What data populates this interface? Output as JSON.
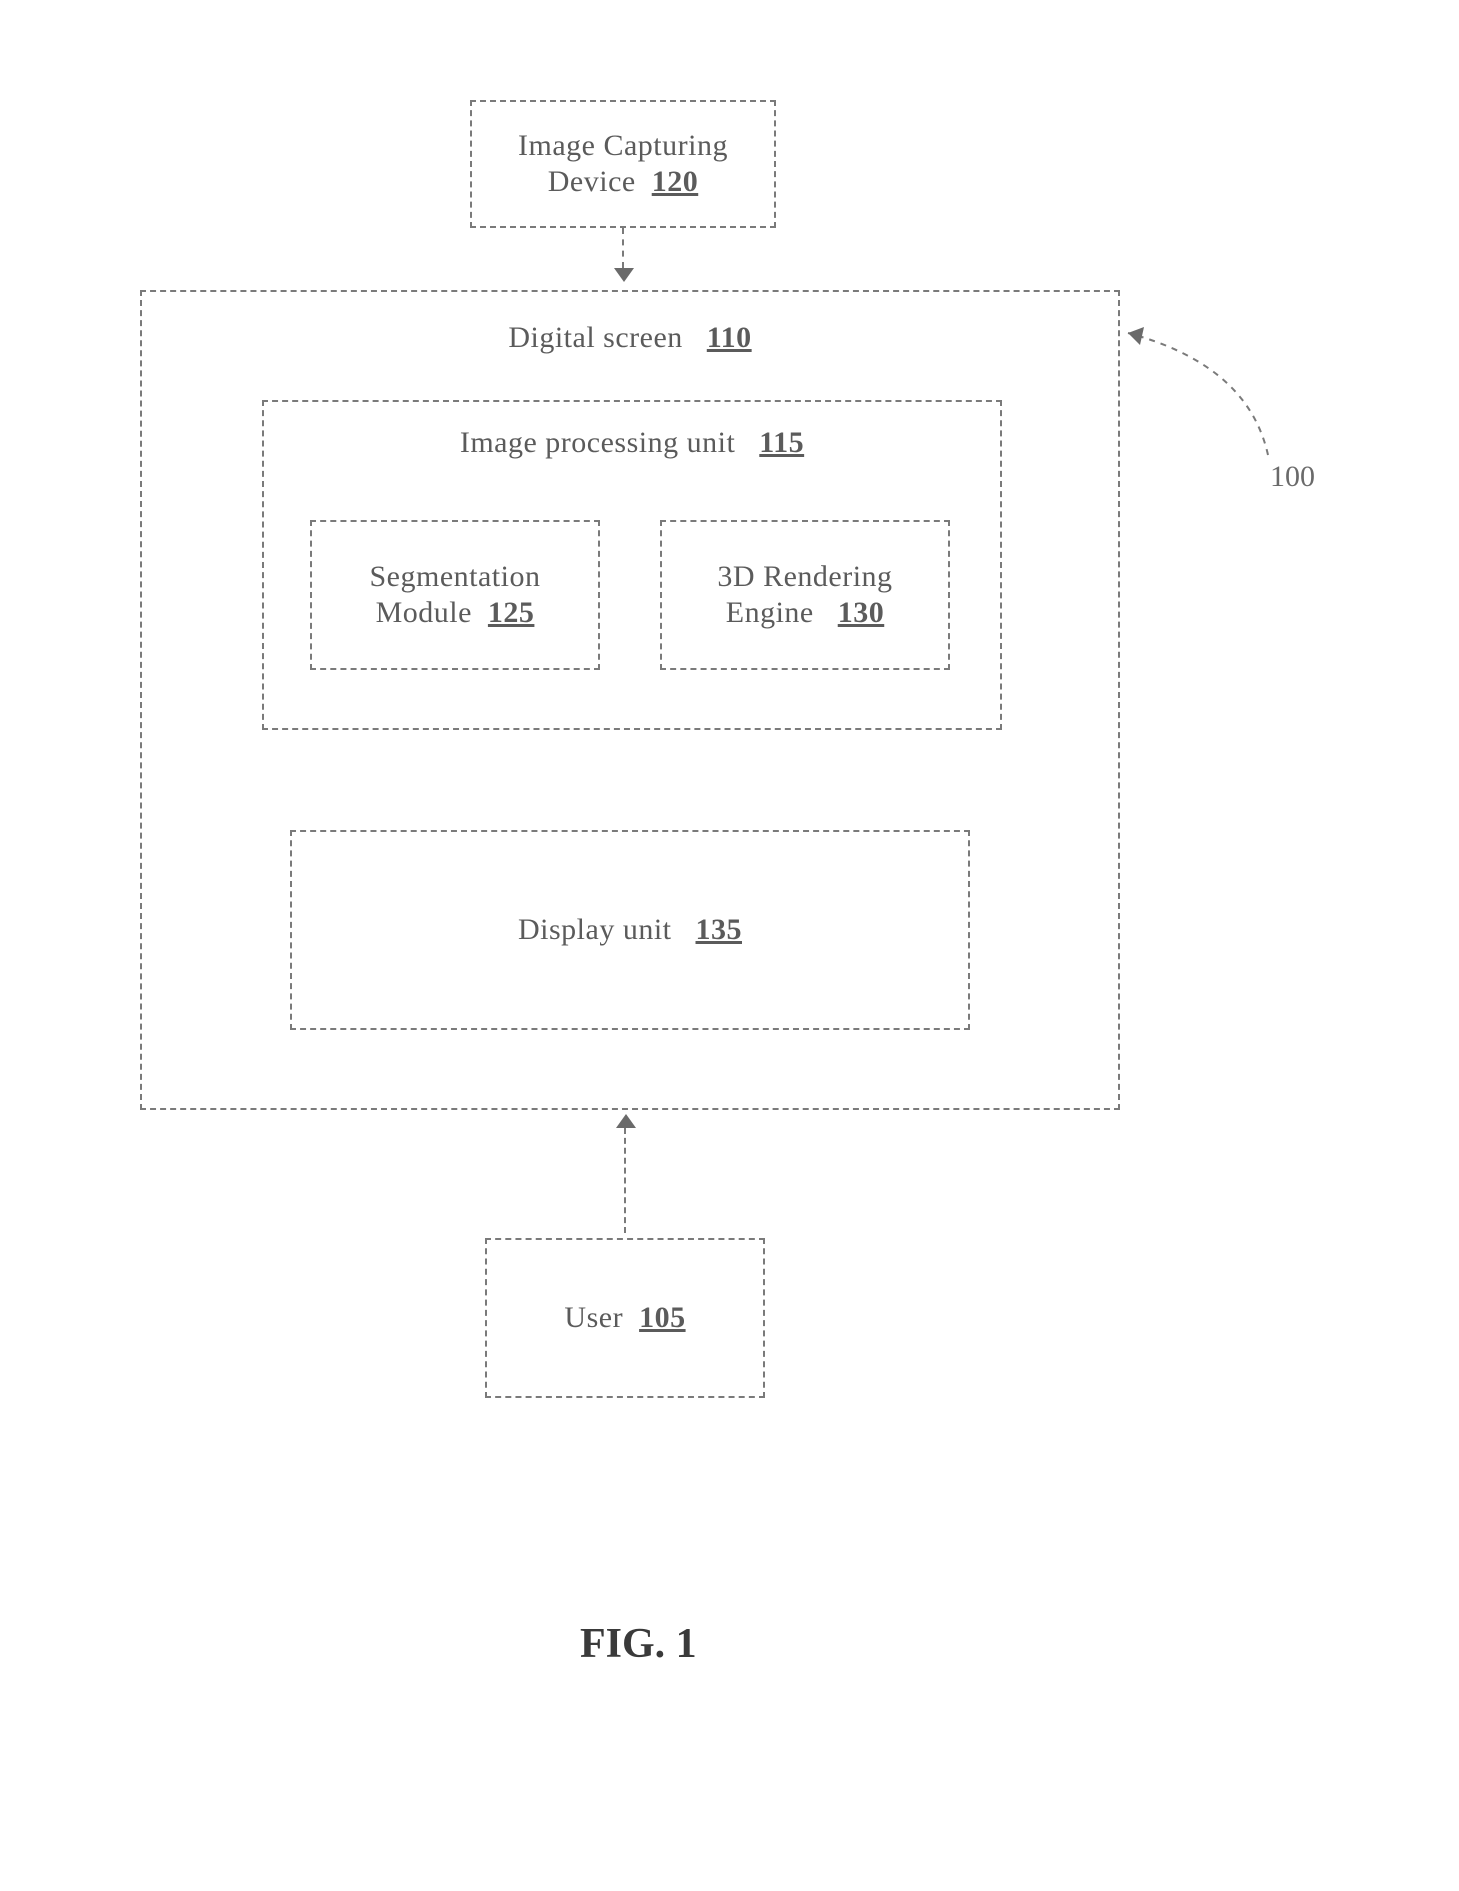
{
  "blocks": {
    "image_capturing": {
      "text": "Image Capturing Device",
      "num": "120"
    },
    "digital_screen": {
      "text": "Digital screen",
      "num": "110"
    },
    "ipu": {
      "text": "Image processing unit",
      "num": "115"
    },
    "segmentation": {
      "text": "Segmentation Module",
      "num": "125"
    },
    "rendering": {
      "text": "3D Rendering Engine",
      "num": "130"
    },
    "display": {
      "text": "Display unit",
      "num": "135"
    },
    "user": {
      "text": "User",
      "num": "105"
    }
  },
  "reference": "100",
  "caption": "FIG. 1"
}
